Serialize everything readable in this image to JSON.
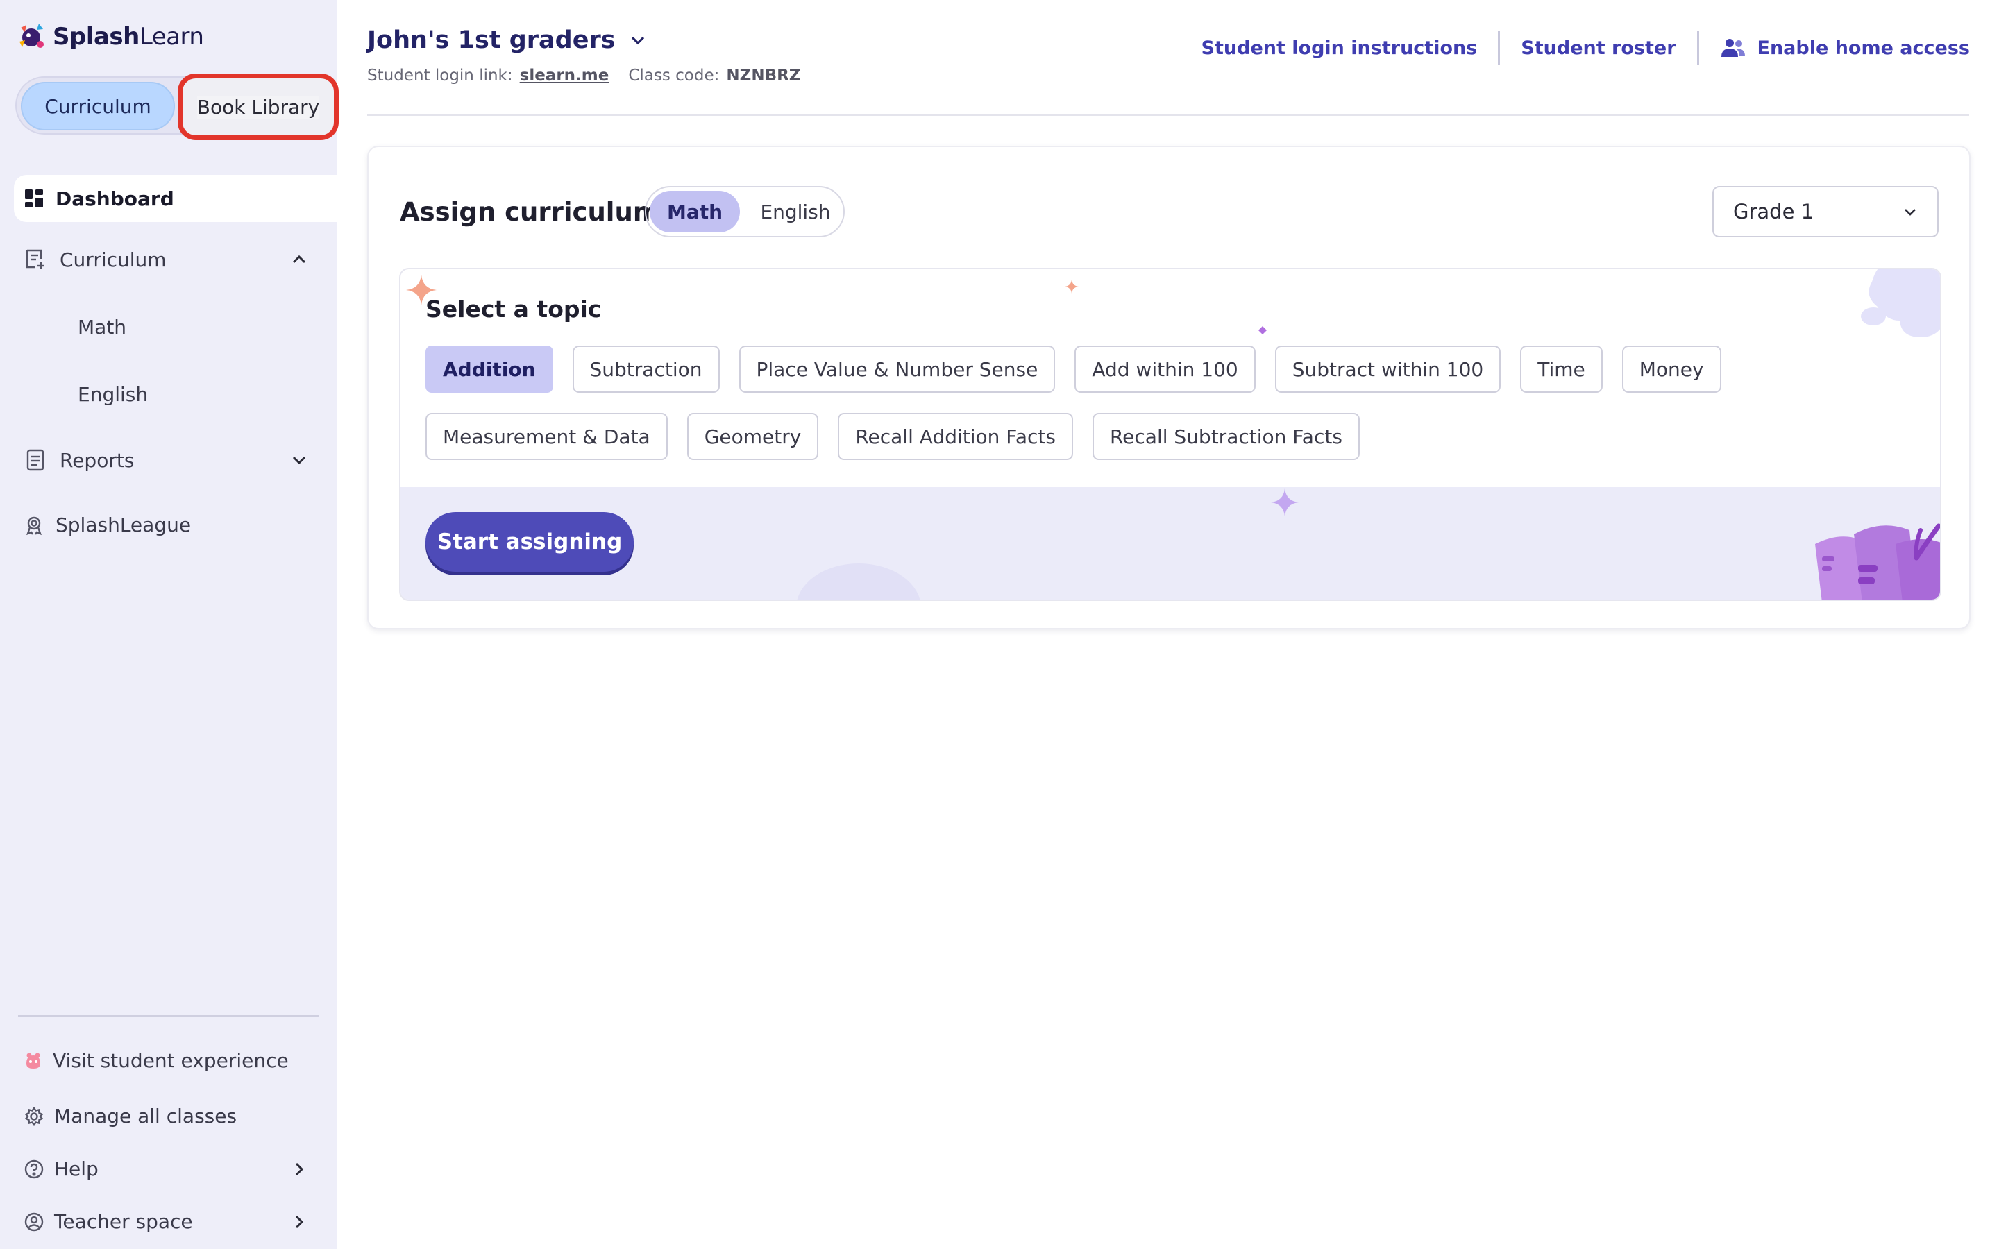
{
  "app": {
    "brand_bold": "Splash",
    "brand_light": "Learn"
  },
  "sidebar": {
    "library_toggle": {
      "curriculum": "Curriculum",
      "book_library": "Book Library"
    },
    "dashboard": "Dashboard",
    "curriculum": "Curriculum",
    "curriculum_children": [
      "Math",
      "English"
    ],
    "reports": "Reports",
    "splash_league": "SplashLeague",
    "footer": {
      "visit_student": "Visit student experience",
      "manage_classes": "Manage all classes",
      "help": "Help",
      "teacher_space": "Teacher space"
    }
  },
  "header": {
    "class_name": "John's 1st graders",
    "login_link_label": "Student login link:",
    "login_link": "slearn.me",
    "class_code_label": "Class code:",
    "class_code": "NZNBRZ",
    "links": {
      "login_instructions": "Student login instructions",
      "roster": "Student roster",
      "home_access": "Enable home access"
    }
  },
  "assign": {
    "title": "Assign curriculum",
    "subjects": {
      "active": "Math",
      "inactive": "English"
    },
    "grade": "Grade 1",
    "topic_title": "Select a topic",
    "topics_row1": [
      "Addition",
      "Subtraction",
      "Place Value & Number Sense",
      "Add within 100",
      "Subtract within 100",
      "Time",
      "Money"
    ],
    "topics_row2": [
      "Measurement & Data",
      "Geometry",
      "Recall Addition Facts",
      "Recall Subtraction Facts"
    ],
    "selected_topic": "Addition",
    "start_button": "Start assigning"
  },
  "colors": {
    "sidebar_bg": "#eeeef9",
    "accent": "#4e4bb8",
    "link": "#3f3db0",
    "highlight_border": "#e2352b",
    "chip_active": "#c9c9f5"
  },
  "icons": {
    "dashboard": "dashboard-grid-icon",
    "curriculum": "curriculum-list-icon",
    "reports": "reports-doc-icon",
    "league": "award-ribbon-icon",
    "visit": "student-face-icon",
    "manage": "gear-icon",
    "help": "help-circle-icon",
    "teacher": "user-circle-icon",
    "home_access": "users-icon"
  }
}
